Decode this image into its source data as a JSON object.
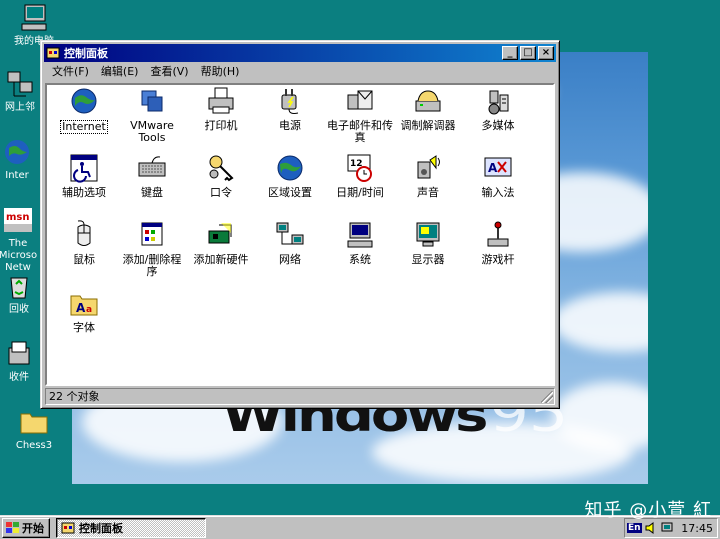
{
  "desktop": {
    "icons": [
      {
        "label": "我的电脑"
      },
      {
        "label": "网上邻"
      },
      {
        "label": "Inter"
      },
      {
        "label": "The Microso Netw"
      },
      {
        "label": "回收"
      },
      {
        "label": "收件"
      },
      {
        "label": "Chess3"
      }
    ],
    "wallpaper_logo": "Windows",
    "wallpaper_version": "95"
  },
  "window": {
    "title": "控制面板",
    "menu": [
      "文件(F)",
      "编辑(E)",
      "查看(V)",
      "帮助(H)"
    ],
    "items": [
      {
        "label": "Internet",
        "icon": "internet-globe-icon"
      },
      {
        "label": "VMware Tools",
        "icon": "vmware-tools-icon"
      },
      {
        "label": "打印机",
        "icon": "printer-icon"
      },
      {
        "label": "电源",
        "icon": "power-plug-icon"
      },
      {
        "label": "电子邮件和传真",
        "icon": "mail-fax-icon"
      },
      {
        "label": "调制解调器",
        "icon": "modem-phone-icon"
      },
      {
        "label": "多媒体",
        "icon": "multimedia-icon"
      },
      {
        "label": "辅助选项",
        "icon": "accessibility-icon"
      },
      {
        "label": "键盘",
        "icon": "keyboard-icon"
      },
      {
        "label": "口令",
        "icon": "password-keys-icon"
      },
      {
        "label": "区域设置",
        "icon": "regional-globe-icon"
      },
      {
        "label": "日期/时间",
        "icon": "date-time-icon"
      },
      {
        "label": "声音",
        "icon": "sound-speaker-icon"
      },
      {
        "label": "输入法",
        "icon": "input-method-icon"
      },
      {
        "label": "鼠标",
        "icon": "mouse-icon"
      },
      {
        "label": "添加/删除程序",
        "icon": "add-remove-programs-icon"
      },
      {
        "label": "添加新硬件",
        "icon": "add-hardware-icon"
      },
      {
        "label": "网络",
        "icon": "network-icon"
      },
      {
        "label": "系统",
        "icon": "system-computer-icon"
      },
      {
        "label": "显示器",
        "icon": "display-monitor-icon"
      },
      {
        "label": "游戏杆",
        "icon": "joystick-icon"
      },
      {
        "label": "字体",
        "icon": "fonts-folder-icon"
      }
    ],
    "status": "22 个对象"
  },
  "taskbar": {
    "start_label": "开始",
    "task_label": "控制面板",
    "lang": "En",
    "clock": "17:45"
  },
  "watermark": "知乎 @小萱 紅"
}
